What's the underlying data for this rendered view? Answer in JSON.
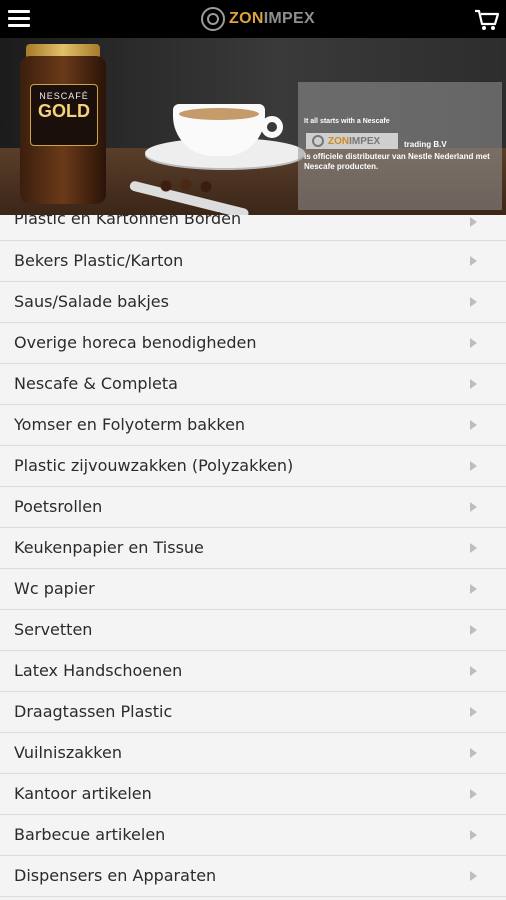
{
  "header": {
    "menu_icon": "hamburger-icon",
    "logo_zon": "ZON",
    "logo_impex": "IMPEX",
    "cart_icon": "shopping-cart-icon"
  },
  "banner": {
    "product_brand": "NESCAFÉ",
    "product_name": "GOLD",
    "tagline": "It all starts with a Nescafe",
    "partner_zon": "ZON",
    "partner_impex": "IMPEX",
    "partner_suffix": "trading B.V",
    "description": "is officiele distributeur van Nestle Nederland met Nescafe producten."
  },
  "categories": [
    "Plastic en Kartonnen Borden",
    "Bekers Plastic/Karton",
    "Saus/Salade bakjes",
    "Overige horeca benodigheden",
    "Nescafe & Completa",
    "Yomser en Folyoterm bakken",
    "Plastic zijvouwzakken (Polyzakken)",
    "Poetsrollen",
    "Keukenpapier en Tissue",
    "Wc papier",
    "Servetten",
    "Latex Handschoenen",
    "Draagtassen Plastic",
    "Vuilniszakken",
    "Kantoor artikelen",
    "Barbecue artikelen",
    "Dispensers en Apparaten"
  ],
  "colors": {
    "header_bg": "#000000",
    "accent": "#e0a33a",
    "list_bg": "#f4f4f4"
  }
}
